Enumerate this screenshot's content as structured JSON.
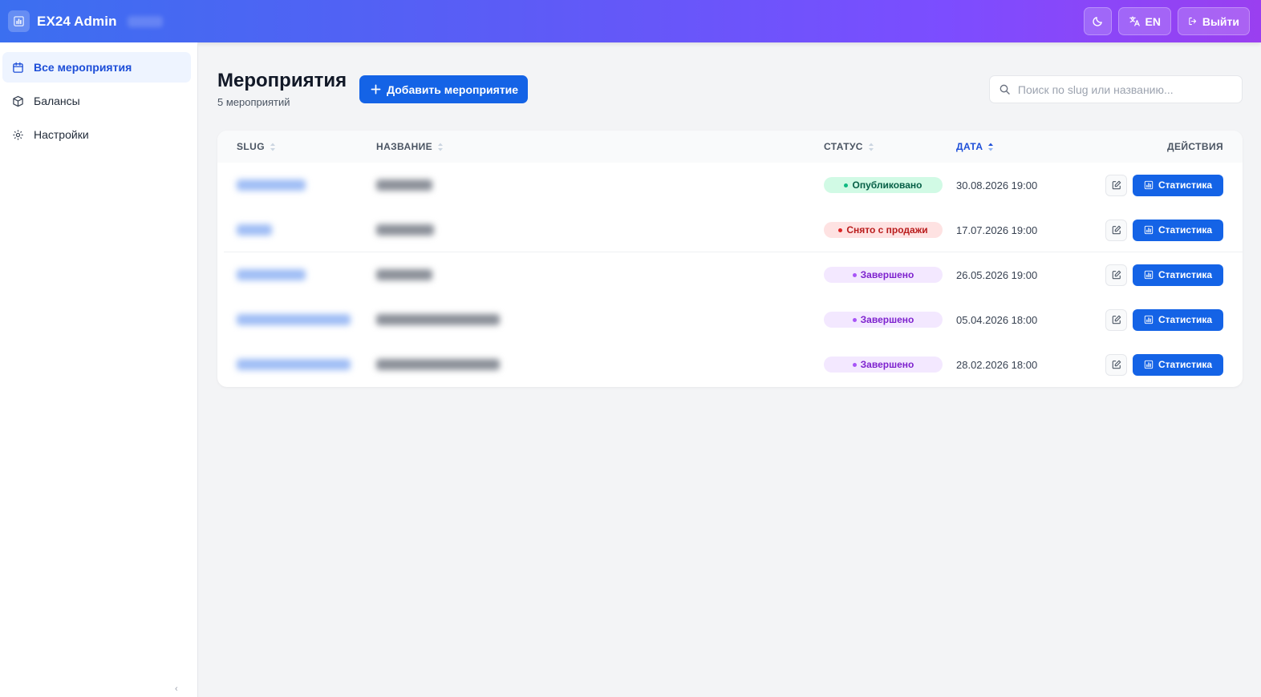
{
  "header": {
    "app_title": "EX24 Admin",
    "lang_label": "EN",
    "logout_label": "Выйти"
  },
  "sidebar": {
    "items": [
      {
        "label": "Все мероприятия",
        "icon": "calendar-icon",
        "active": true
      },
      {
        "label": "Балансы",
        "icon": "box-icon",
        "active": false
      },
      {
        "label": "Настройки",
        "icon": "gear-icon",
        "active": false
      }
    ]
  },
  "page": {
    "title": "Мероприятия",
    "subtitle": "5 мероприятий",
    "add_button": "Добавить мероприятие",
    "search_placeholder": "Поиск по slug или названию..."
  },
  "table": {
    "columns": {
      "slug": "SLUG",
      "name": "НАЗВАНИЕ",
      "status": "СТАТУС",
      "date": "ДАТА",
      "actions": "ДЕЙСТВИЯ"
    },
    "stat_button": "Статистика",
    "rows": [
      {
        "status": "Опубликовано",
        "status_kind": "published",
        "date": "30.08.2026 19:00"
      },
      {
        "status": "Снято с продажи",
        "status_kind": "off",
        "date": "17.07.2026 19:00"
      },
      {
        "status": "Завершено",
        "status_kind": "done",
        "date": "26.05.2026 19:00"
      },
      {
        "status": "Завершено",
        "status_kind": "done",
        "date": "05.04.2026 18:00"
      },
      {
        "status": "Завершено",
        "status_kind": "done",
        "date": "28.02.2026 18:00"
      }
    ]
  },
  "colors": {
    "accent": "#1463e6",
    "header_gradient_start": "#3b6ff0",
    "header_gradient_end": "#9a3ff0"
  }
}
